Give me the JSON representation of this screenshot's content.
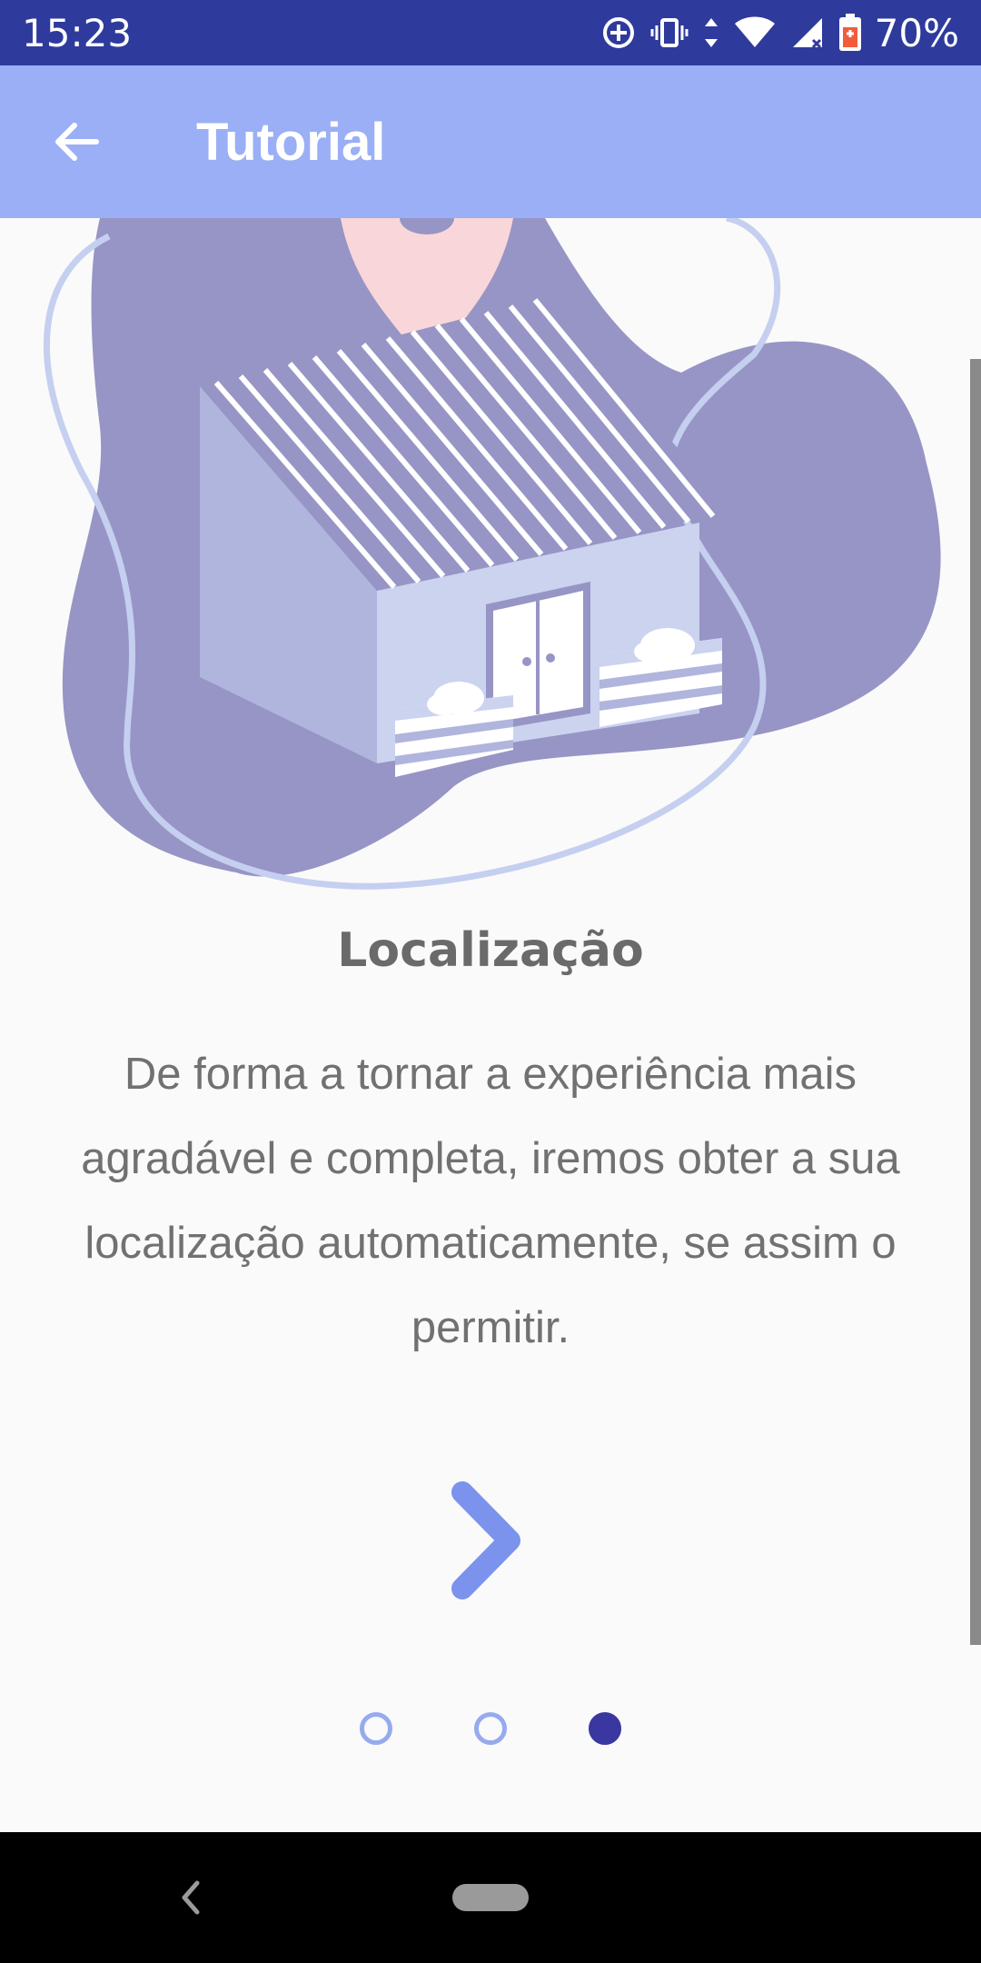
{
  "status_bar": {
    "time": "15:23",
    "battery": "70%"
  },
  "app_bar": {
    "title": "Tutorial",
    "back_icon": "arrow-back-icon"
  },
  "content": {
    "title": "Localização",
    "description": "De forma a tornar a experiência mais agradável e completa, iremos obter a sua localização automaticamente, se assim o permitir.",
    "next_icon": "chevron-right-icon"
  },
  "pager": {
    "pages": 3,
    "active_index": 2
  },
  "colors": {
    "status_bar": "#2e3b9c",
    "app_bar": "#9aaff5",
    "accent": "#7b93ec",
    "dot_active": "#3a37a0",
    "blob": "#9795c5"
  }
}
